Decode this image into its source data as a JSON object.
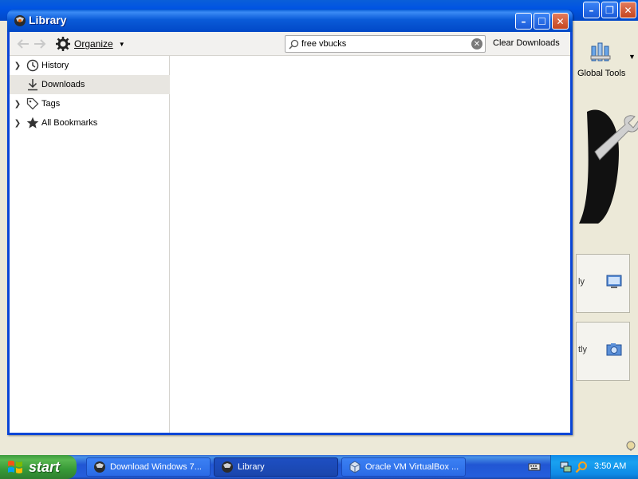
{
  "background_window": {
    "global_tools_label": "Global Tools",
    "card1_snippet": "ly",
    "card2_snippet": "tly"
  },
  "library": {
    "title": "Library",
    "toolbar": {
      "organize_label": "Organize",
      "search_value": "free vbucks",
      "clear_downloads_label": "Clear Downloads"
    },
    "sidebar": {
      "items": [
        {
          "label": "History",
          "icon": "clock-icon",
          "expandable": true
        },
        {
          "label": "Downloads",
          "icon": "download-icon",
          "expandable": false,
          "selected": true
        },
        {
          "label": "Tags",
          "icon": "tag-icon",
          "expandable": true
        },
        {
          "label": "All Bookmarks",
          "icon": "star-icon",
          "expandable": true
        }
      ]
    }
  },
  "taskbar": {
    "start_label": "start",
    "tasks": [
      {
        "label": "Download Windows 7...",
        "icon": "firefox-icon"
      },
      {
        "label": "Library",
        "icon": "firefox-icon",
        "active": true
      },
      {
        "label": "Oracle VM VirtualBox ...",
        "icon": "virtualbox-icon"
      }
    ],
    "clock": "3:50 AM"
  },
  "colors": {
    "xp_title_blue": "#0054e3",
    "taskbar_blue": "#245edc",
    "start_green": "#3c9a3c",
    "tray_blue": "#0f8be9",
    "selected_row": "#e8e6e1"
  }
}
